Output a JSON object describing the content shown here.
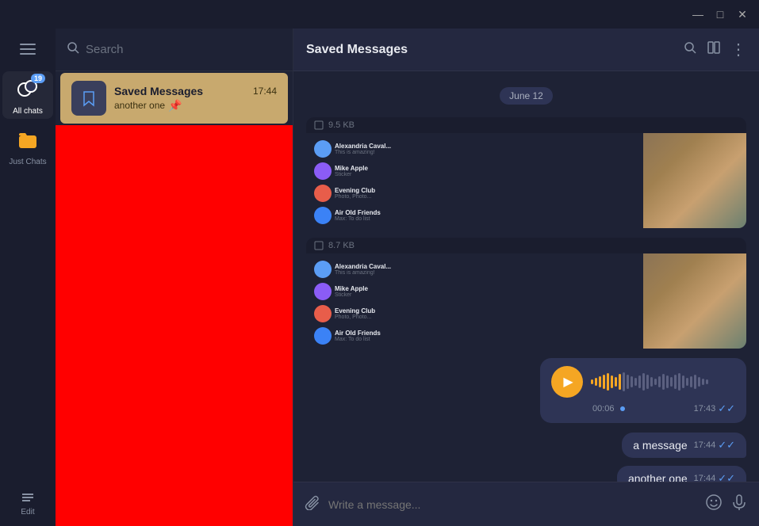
{
  "titlebar": {
    "minimize": "—",
    "maximize": "□",
    "close": "✕"
  },
  "sidebar": {
    "hamburger_label": "menu",
    "all_chats_label": "All chats",
    "all_chats_badge": "19",
    "just_chats_label": "Just Chats",
    "edit_label": "Edit"
  },
  "search": {
    "placeholder": "Search"
  },
  "chat_item": {
    "name": "Saved Messages",
    "time": "17:44",
    "preview": "another one",
    "pin": "📌"
  },
  "chat_header": {
    "title": "Saved Messages",
    "search_icon": "🔍",
    "layout_icon": "⊟",
    "more_icon": "⋮"
  },
  "date_divider": "June 12",
  "screenshot_label_1": "9.5 KB",
  "screenshot_label_2": "8.7 KB",
  "audio": {
    "duration": "00:06",
    "time": "17:43"
  },
  "messages": [
    {
      "text": "a message",
      "time": "17:44"
    },
    {
      "text": "another one",
      "time": "17:44"
    }
  ],
  "input_placeholder": "Write a message...",
  "waveform_heights": [
    6,
    10,
    14,
    18,
    22,
    16,
    12,
    20,
    24,
    18,
    14,
    10,
    16,
    22,
    18,
    12,
    8,
    14,
    20,
    16,
    12,
    18,
    22,
    16,
    10,
    14,
    18,
    12,
    8,
    6
  ]
}
